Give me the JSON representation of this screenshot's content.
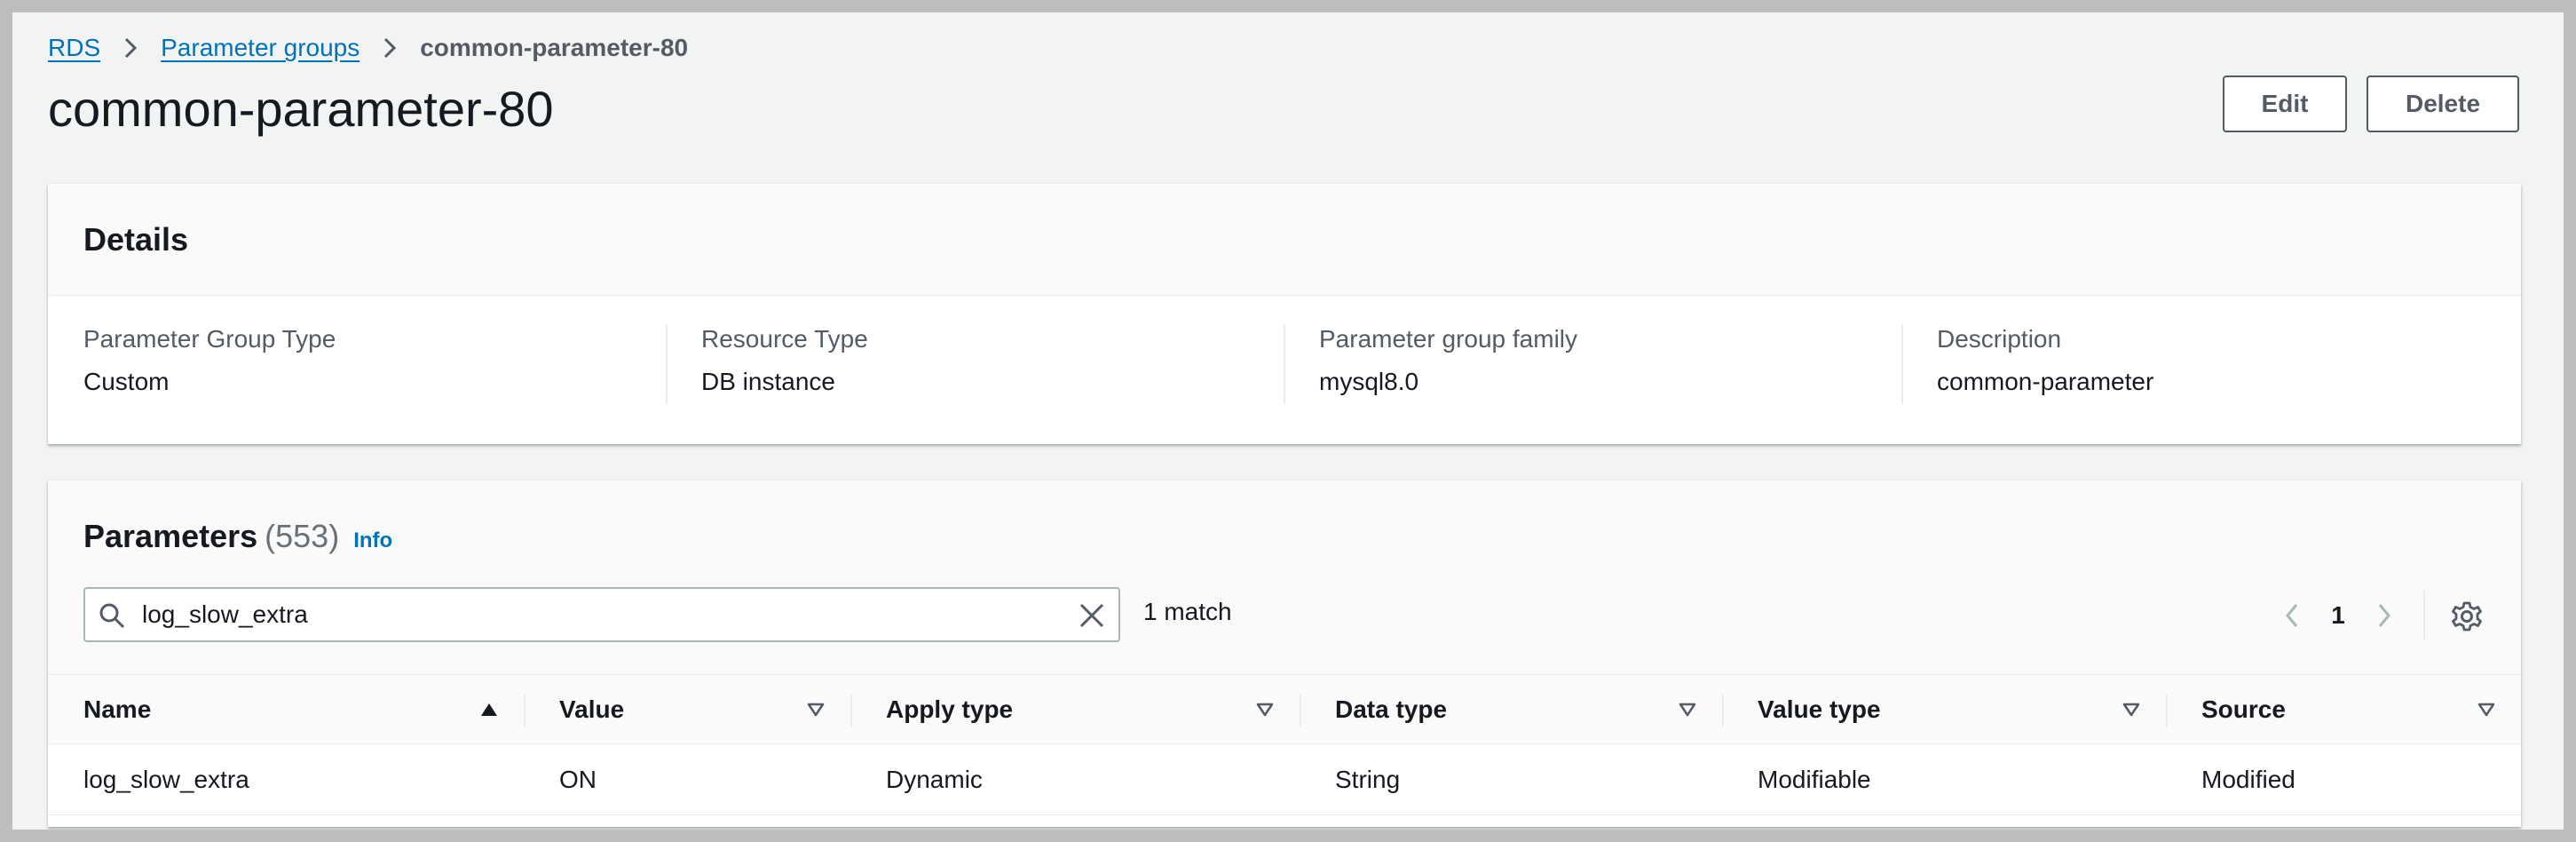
{
  "breadcrumb": {
    "root": "RDS",
    "parent": "Parameter groups",
    "current": "common-parameter-80"
  },
  "page": {
    "title": "common-parameter-80"
  },
  "actions": {
    "edit": "Edit",
    "delete": "Delete"
  },
  "details": {
    "title": "Details",
    "fields": [
      {
        "label": "Parameter Group Type",
        "value": "Custom"
      },
      {
        "label": "Resource Type",
        "value": "DB instance"
      },
      {
        "label": "Parameter group family",
        "value": "mysql8.0"
      },
      {
        "label": "Description",
        "value": "common-parameter"
      }
    ]
  },
  "parameters": {
    "title": "Parameters",
    "count": "(553)",
    "info": "Info",
    "search": {
      "value": "log_slow_extra",
      "placeholder": ""
    },
    "match_count": "1 match",
    "pagination": {
      "current_page": "1"
    },
    "columns": [
      "Name",
      "Value",
      "Apply type",
      "Data type",
      "Value type",
      "Source"
    ],
    "sort": {
      "column": "Name",
      "direction": "ascending"
    },
    "rows": [
      {
        "name": "log_slow_extra",
        "value": "ON",
        "apply_type": "Dynamic",
        "data_type": "String",
        "value_type": "Modifiable",
        "source": "Modified"
      }
    ]
  },
  "icons": {
    "breadcrumb_separator": "chevron-right-icon",
    "search": "search-icon",
    "clear": "close-icon",
    "prev": "chevron-left-icon",
    "next": "chevron-right-icon",
    "settings": "gear-icon",
    "sort_asc": "caret-up-icon",
    "filter": "caret-down-outline-icon"
  },
  "colors": {
    "link": "#0073bb",
    "text": "#16191f",
    "muted": "#545b64",
    "background": "#f2f3f3",
    "panel_header": "#fafafa"
  }
}
